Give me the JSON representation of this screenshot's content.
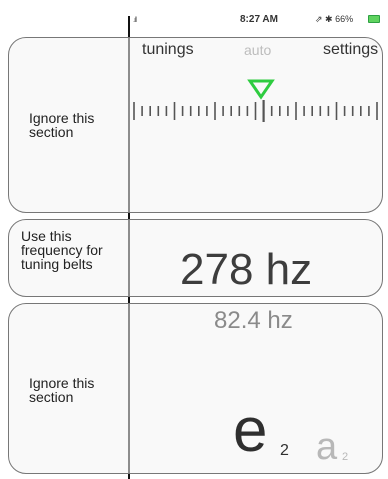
{
  "status": {
    "time": "8:27 AM",
    "right": "⇗ ✱ 66%"
  },
  "nav": {
    "tunings": "tunings",
    "auto": "auto",
    "settings": "settings"
  },
  "annotations": {
    "top": [
      "Ignore this",
      "section"
    ],
    "middle": [
      "Use this",
      "frequency for",
      "tuning belts"
    ],
    "bottom": [
      "Ignore this",
      "section"
    ]
  },
  "tuner": {
    "frequency": "278 hz",
    "reference_frequency": "82.4 hz",
    "current_note": "e",
    "current_octave": "2",
    "next_note": "a",
    "next_octave": "2",
    "indicator_color": "#2ecc40"
  }
}
